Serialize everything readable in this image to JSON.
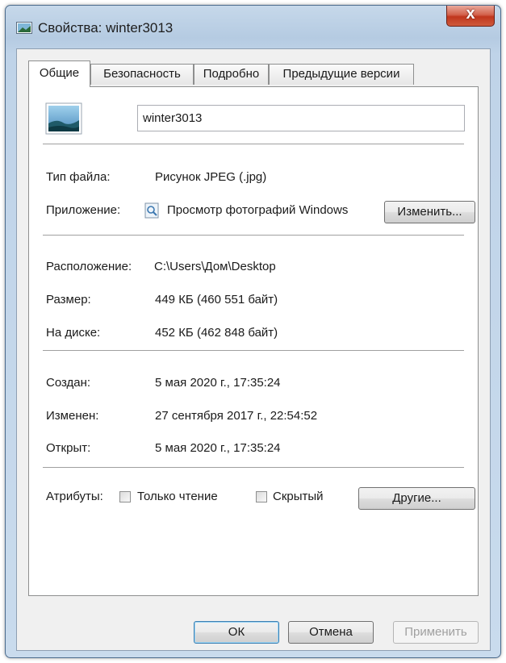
{
  "window": {
    "title": "Свойства: winter3013",
    "close_label": "x"
  },
  "tabs": [
    {
      "label": "Общие",
      "active": true
    },
    {
      "label": "Безопасность",
      "active": false
    },
    {
      "label": "Подробно",
      "active": false
    },
    {
      "label": "Предыдущие версии",
      "active": false
    }
  ],
  "general": {
    "file_name": "winter3013",
    "file_type": {
      "label": "Тип файла:",
      "value": "Рисунок JPEG (.jpg)"
    },
    "application": {
      "label": "Приложение:",
      "value": "Просмотр фотографий Windows",
      "change_button": "Изменить..."
    },
    "location": {
      "label": "Расположение:",
      "value": "C:\\Users\\Дом\\Desktop"
    },
    "size": {
      "label": "Размер:",
      "value": "449 КБ (460 551 байт)"
    },
    "on_disk": {
      "label": "На диске:",
      "value": "452 КБ (462 848 байт)"
    },
    "created": {
      "label": "Создан:",
      "value": "5 мая 2020 г., 17:35:24"
    },
    "modified": {
      "label": "Изменен:",
      "value": "27 сентября 2017 г., 22:54:52"
    },
    "accessed": {
      "label": "Открыт:",
      "value": "5 мая 2020 г., 17:35:24"
    },
    "attributes": {
      "label": "Атрибуты:",
      "readonly_label": "Только чтение",
      "readonly_checked": false,
      "hidden_label": "Скрытый",
      "hidden_checked": false,
      "other_button": "Другие..."
    }
  },
  "footer": {
    "ok": "ОК",
    "cancel": "Отмена",
    "apply": "Применить"
  },
  "colors": {
    "title_bar": "#bfd3e8",
    "close_button": "#c0371d",
    "default_button_border": "#3c7fb1"
  }
}
